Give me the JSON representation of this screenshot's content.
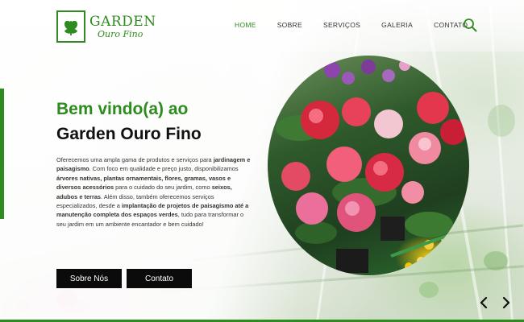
{
  "brand": {
    "name": "GARDEN",
    "tagline": "Ouro Fino",
    "logo_icon": "leaf-logo-icon",
    "color": "#2e8b1f"
  },
  "nav": {
    "items": [
      {
        "label": "HOME",
        "active": true
      },
      {
        "label": "SOBRE",
        "active": false
      },
      {
        "label": "SERVIÇOS",
        "active": false
      },
      {
        "label": "GALERIA",
        "active": false
      },
      {
        "label": "CONTATO",
        "active": false
      }
    ],
    "search_icon": "search-icon"
  },
  "hero": {
    "title_line1": "Bem vindo(a) ao",
    "title_line2": "Garden Ouro Fino",
    "description_parts": {
      "p1": "Oferecemos uma ampla gama de produtos e serviços para ",
      "b1": "jardinagem e paisagismo",
      "p2": ". Com foco em qualidade e preço justo, disponibilizamos ",
      "b2": "árvores nativas, plantas ornamentais, flores, gramas, vasos e diversos acessórios",
      "p3": " para o cuidado do seu jardim, como ",
      "b3": "seixos, adubos e terras",
      "p4": ". Além disso, também oferecemos serviços especializados, desde a ",
      "b4": "implantação de projetos de paisagismo até a manutenção completa dos espaços verdes",
      "p5": ", tudo para transformar o seu jardim em um ambiente encantador e bem cuidado!"
    },
    "buttons": {
      "sobre": "Sobre Nós",
      "contato": "Contato"
    }
  },
  "carousel": {
    "prev_icon": "chevron-left-icon",
    "next_icon": "chevron-right-icon"
  },
  "colors": {
    "accent": "#2e8b1f",
    "button_bg": "#0b0b0b",
    "text_dark": "#111111"
  }
}
